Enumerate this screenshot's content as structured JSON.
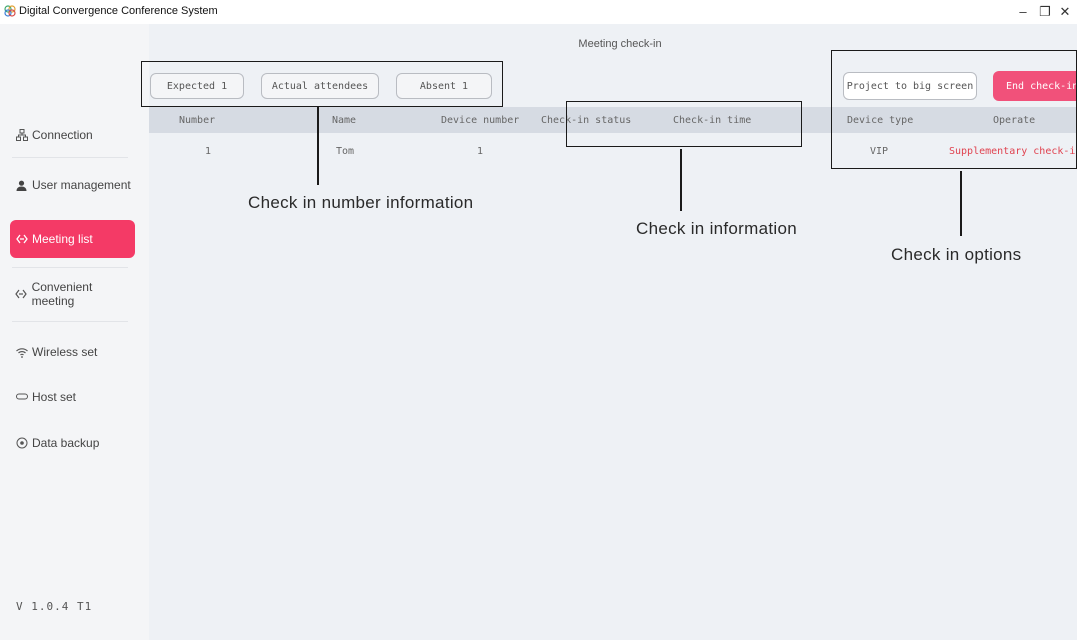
{
  "window": {
    "title": "Digital Convergence Conference System",
    "controls": {
      "minimize": "–",
      "restore": "❐",
      "close": "✕"
    },
    "icon": "app-logo-icon"
  },
  "sidebar": {
    "items": [
      {
        "label": "Connection",
        "icon": "connection-icon",
        "active": false
      },
      {
        "label": "User management",
        "icon": "user-icon",
        "active": false
      },
      {
        "label": "Meeting list",
        "icon": "meeting-icon",
        "active": true
      },
      {
        "label": "Convenient meeting",
        "icon": "meeting-icon",
        "active": false
      },
      {
        "label": "Wireless set",
        "icon": "wifi-icon",
        "active": false
      },
      {
        "label": "Host set",
        "icon": "host-icon",
        "active": false
      },
      {
        "label": "Data backup",
        "icon": "backup-icon",
        "active": false
      }
    ],
    "version": "V 1.0.4 T1"
  },
  "main": {
    "title": "Meeting check-in",
    "stats": {
      "expected": "Expected 1",
      "actual": "Actual attendees",
      "absent": "Absent 1"
    },
    "buttons": {
      "project": "Project to big screen",
      "end": "End check-in"
    },
    "table": {
      "headers": [
        "Number",
        "Name",
        "Device number",
        "Check-in status",
        "Check-in time",
        "Device type",
        "Operate"
      ],
      "rows": [
        {
          "number": "1",
          "name": "Tom",
          "device_number": "1",
          "status": "",
          "time": "",
          "device_type": "VIP",
          "operate": "Supplementary check-in"
        }
      ]
    }
  },
  "annotations": {
    "number_info": "Check in number information",
    "info": "Check in information",
    "options": "Check in options"
  },
  "colors": {
    "accent": "#f43a66",
    "end_button": "#f1517a",
    "operate_text": "#e0424f",
    "table_header": "#d6dbe3",
    "background": "#eef1f5"
  }
}
